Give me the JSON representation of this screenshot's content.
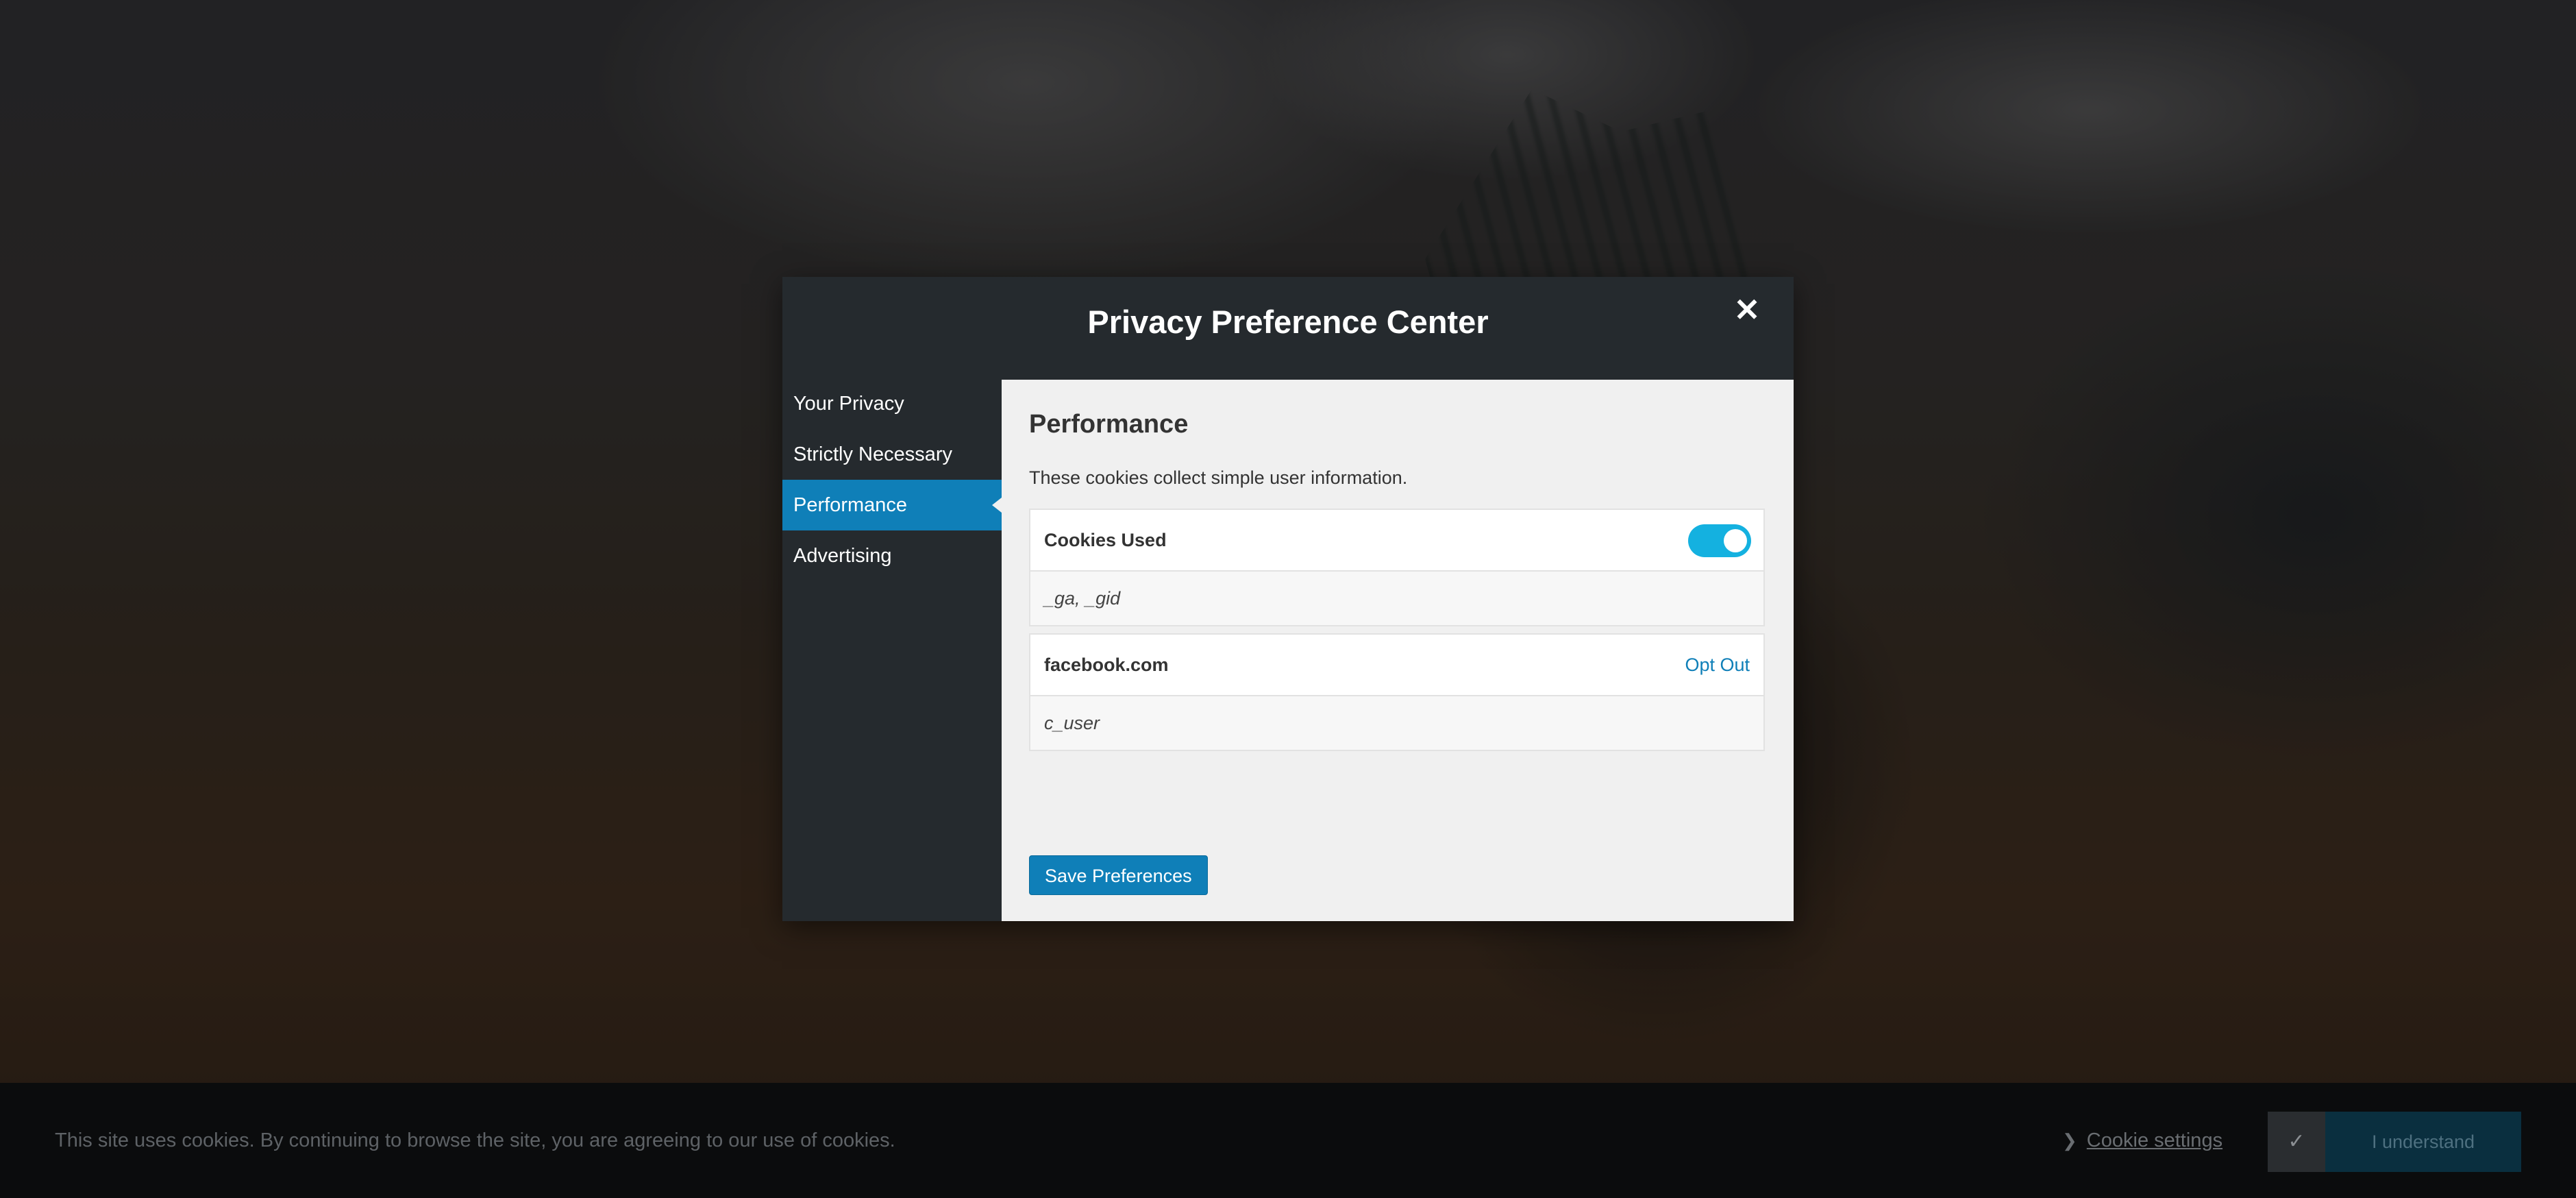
{
  "modal": {
    "title": "Privacy Preference Center",
    "close_symbol": "✕",
    "nav": [
      {
        "label": "Your Privacy",
        "active": false
      },
      {
        "label": "Strictly Necessary",
        "active": false
      },
      {
        "label": "Performance",
        "active": true
      },
      {
        "label": "Advertising",
        "active": false
      }
    ],
    "section": {
      "title": "Performance",
      "description": "These cookies collect simple user information.",
      "cards": [
        {
          "header": "Cookies Used",
          "control": "toggle",
          "toggle_on": true,
          "body": "_ga, _gid"
        },
        {
          "header": "facebook.com",
          "control": "link",
          "link_label": "Opt Out",
          "body": "c_user"
        }
      ]
    },
    "save_label": "Save Preferences"
  },
  "cookie_bar": {
    "text": "This site uses cookies. By continuing to browse the site, you are agreeing to our use of cookies.",
    "settings_label": "Cookie settings",
    "settings_chevron": "❯",
    "understand_check": "✓",
    "understand_label": "I understand"
  },
  "colors": {
    "accent": "#0f7fb8",
    "toggle_on": "#14b1e0",
    "modal_bg": "#252a2e",
    "content_bg": "#f0f0f0"
  },
  "icons": {
    "close": "close-icon",
    "chevron": "chevron-right-icon",
    "check": "check-icon"
  }
}
